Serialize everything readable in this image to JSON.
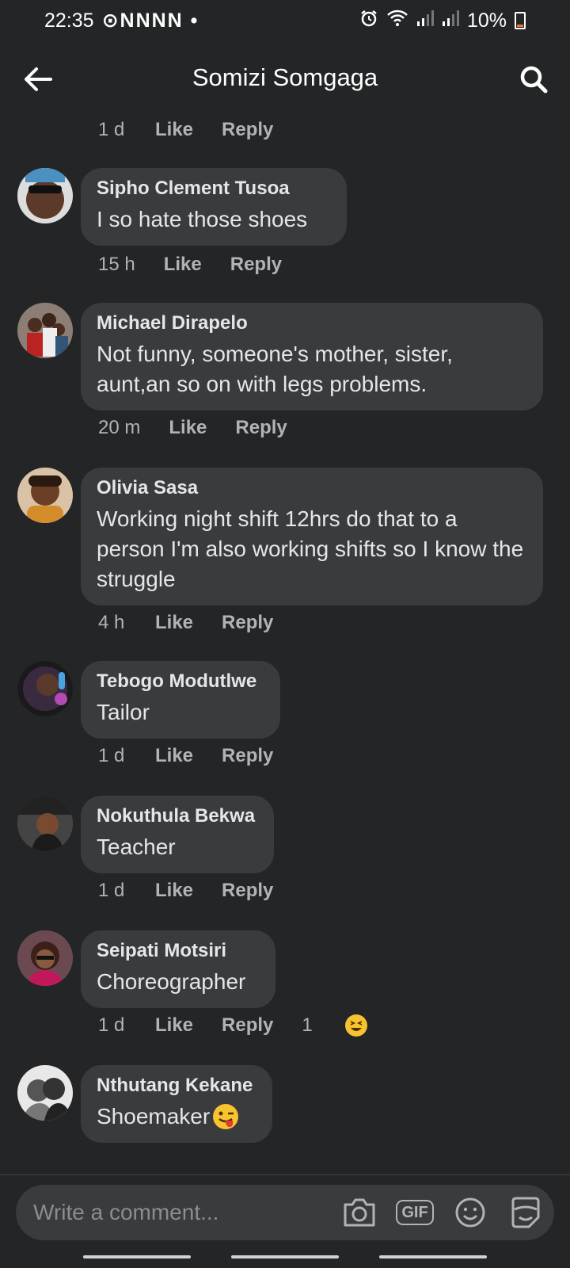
{
  "status": {
    "time": "22:35",
    "notification_icons": "⊙NNNN •",
    "battery": "10%"
  },
  "header": {
    "title": "Somizi Somgaga"
  },
  "top_meta": {
    "time": "1 d",
    "like": "Like",
    "reply": "Reply"
  },
  "comments": [
    {
      "author": "Sipho Clement Tusoa",
      "text": "I so hate those shoes",
      "time": "15 h",
      "like": "Like",
      "reply": "Reply"
    },
    {
      "author": "Michael Dirapelo",
      "text": "Not funny, someone's mother, sister, aunt,an so on with legs problems.",
      "time": "20 m",
      "like": "Like",
      "reply": "Reply"
    },
    {
      "author": "Olivia Sasa",
      "text": "Working night shift 12hrs do that to a person I'm also working shifts so I know the struggle",
      "time": "4 h",
      "like": "Like",
      "reply": "Reply"
    },
    {
      "author": "Tebogo Modutlwe",
      "text": "Tailor",
      "time": "1 d",
      "like": "Like",
      "reply": "Reply"
    },
    {
      "author": "Nokuthula Bekwa",
      "text": "Teacher",
      "time": "1 d",
      "like": "Like",
      "reply": "Reply"
    },
    {
      "author": "Seipati Motsiri",
      "text": "Choreographer",
      "time": "1 d",
      "like": "Like",
      "reply": "Reply",
      "reaction_count": "1"
    },
    {
      "author": "Nthutang Kekane",
      "text": "Shoemaker"
    }
  ],
  "composer": {
    "placeholder": "Write a comment...",
    "gif_label": "GIF"
  }
}
